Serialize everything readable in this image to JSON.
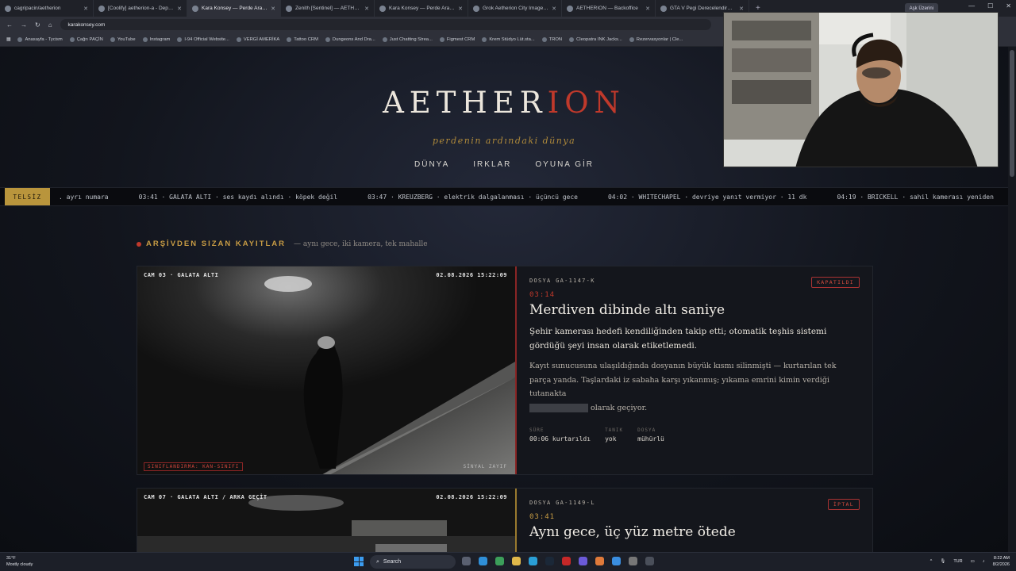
{
  "browser": {
    "tabs": [
      {
        "label": "cagripacin/aetherion",
        "active": false
      },
      {
        "label": "[Coolify] aetherion-a - Deployment",
        "active": false
      },
      {
        "label": "Kara Konsey — Perde Aralanıyor",
        "active": true
      },
      {
        "label": "Zenith [Sentinel] — AETHERION",
        "active": false
      },
      {
        "label": "Kara Konsey — Perde Aralanıyor",
        "active": false
      },
      {
        "label": "Grok Aetherion City Image Prompt",
        "active": false
      },
      {
        "label": "AETHERION — Backoffice",
        "active": false
      },
      {
        "label": "GTA V Pegi Derecelendirmesi",
        "active": false
      }
    ],
    "profile_label": "Aşk Üzerini",
    "url": "karakonsey.com",
    "bookmarks": [
      "Anasayfa - Tycism",
      "Çağrı PAÇİN",
      "YouTube",
      "Instagram",
      "I-94 Official Website...",
      "VERGİ AMERİKA",
      "Tattoo CRM",
      "Dungeons And Dra...",
      "Just Chatting Strea...",
      "Figmest CRM",
      "Krem Stüdyo Lüt.sta...",
      "TRON",
      "Cleopatra INK Jacks...",
      "Rezervasyonlar | Cle..."
    ]
  },
  "site": {
    "logo_part1": "AETHER",
    "logo_part2": "ION",
    "tagline": "perdenin ardındaki dünya",
    "nav": [
      "DÜNYA",
      "IRKLAR",
      "OYUNA GİR"
    ],
    "ticker_label": "TELSİZ",
    "ticker_items": [
      ". ayrı numara",
      "03:41 · GALATA ALTI · ses kaydı alındı · köpek değil",
      "03:47 · KREUZBERG · elektrik dalgalanması · üçüncü gece",
      "04:02 · WHITECHAPEL · devriye yanıt vermiyor · 11 dk",
      "04:19 · BRICKELL · sahil kamerası yeniden"
    ],
    "section_title": "ARŞİVDEN SIZAN KAYITLAR",
    "section_subtitle": "— aynı gece, iki kamera, tek mahalle",
    "cards": [
      {
        "cam_label": "CAM 03 · GALATA ALTI",
        "cam_time": "02.08.2026 15:22:09",
        "classification": "SINIFLANDIRMA: KAN-SINIFI",
        "signal": "SİNYAL ZAYIF",
        "file": "DOSYA GA-1147-K",
        "badge": "KAPATILDI",
        "time": "03:14",
        "title": "Merdiven dibinde altı saniye",
        "lead": "Şehir kamerası hedefi kendiliğinden takip etti; otomatik teşhis sistemi gördüğü şeyi insan olarak etiketlemedi.",
        "body_before": "Kayıt sunucusuna ulaşıldığında dosyanın büyük kısmı silinmişti — kurtarılan tek parça yanda. Taşlardaki iz sabaha karşı yıkanmış; yıkama emrini kimin verdiği tutanakta",
        "body_after": "olarak geçiyor.",
        "stats": [
          {
            "k": "SÜRE",
            "v": "00:06 kurtarıldı"
          },
          {
            "k": "TANIK",
            "v": "yok"
          },
          {
            "k": "DOSYA",
            "v": "mühürlü"
          }
        ]
      },
      {
        "cam_label": "CAM 07 · GALATA ALTI / ARKA GEÇİT",
        "cam_time": "02.08.2026 15:22:09",
        "file": "DOSYA GA-1149-L",
        "badge": "İPTAL",
        "time": "03:41",
        "title": "Aynı gece, üç yüz metre ötede"
      }
    ]
  },
  "taskbar": {
    "weather_temp": "31°F",
    "weather_desc": "Mostly cloudy",
    "search_placeholder": "Search",
    "lang": "TUR",
    "time": "8:22 AM",
    "date": "8/2/2026"
  }
}
